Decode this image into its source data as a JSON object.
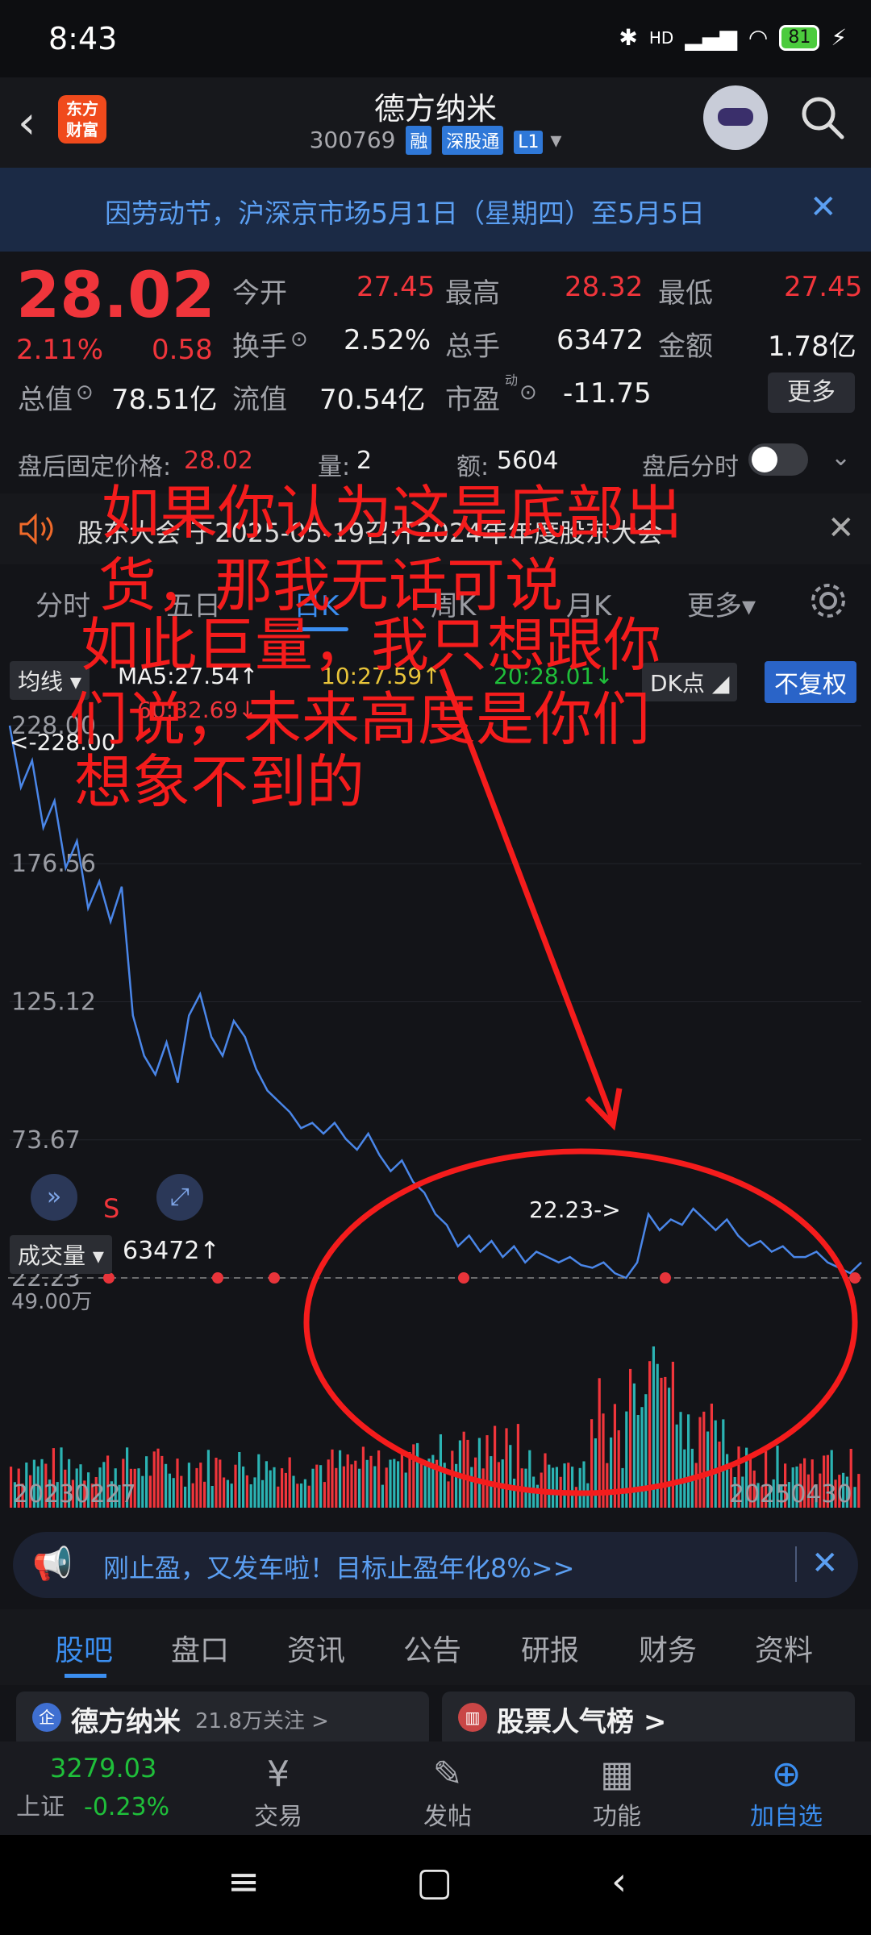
{
  "status_bar": {
    "time": "8:43",
    "battery": "81",
    "network": "HD"
  },
  "header": {
    "back_icon": "chevron-left-icon",
    "logo_text_1": "东方",
    "logo_text_2": "财富",
    "stock_name": "德方纳米",
    "stock_code": "300769",
    "tag_rong": "融",
    "tag_shengutong": "深股通",
    "tag_level": "L1"
  },
  "notice": {
    "text": "因劳动节，沪深京市场5月1日（星期四）至5月5日",
    "close": "✕"
  },
  "quote": {
    "price": "28.02",
    "pct": "2.11%",
    "change": "0.58",
    "open_label": "今开",
    "open": "27.45",
    "high_label": "最高",
    "high": "28.32",
    "low_label": "最低",
    "low": "27.45",
    "turnover_label": "换手",
    "turnover": "2.52%",
    "volume_label": "总手",
    "volume": "63472",
    "amount_label": "金额",
    "amount": "1.78亿",
    "mcap_label": "总值",
    "mcap": "78.51亿",
    "float_label": "流值",
    "float": "70.54亿",
    "pe_label": "市盈",
    "pe_sup": "动",
    "pe": "-11.75",
    "more": "更多"
  },
  "after_hours": {
    "fixed_label": "盘后固定价格:",
    "fixed_price": "28.02",
    "qty_label": "量:",
    "qty": "2",
    "amt_label": "额:",
    "amt": "5604",
    "timeshare_label": "盘后分时"
  },
  "meeting": {
    "text": "股东大会   于2025-05-19召开2024年年度股东大会"
  },
  "period_tabs": [
    "分时",
    "五日",
    "日K",
    "周K",
    "月K",
    "更多▾"
  ],
  "chart": {
    "ma_selector": "均线",
    "ma5": "MA5:27.54↑",
    "ma10": "10:27.59↑",
    "ma20": "20:28.01↓",
    "ma60": "60:32.69↓",
    "dk": "DK点",
    "fuquan": "不复权",
    "max_label": "<-228.00",
    "min_label": "22.23->",
    "s_marker": "S",
    "volume_selector": "成交量",
    "volume_value": "63472↑",
    "vol_axis_top": "49.00万",
    "date_start": "20230227",
    "date_end": "20250430"
  },
  "chart_data": {
    "type": "line",
    "title": "",
    "y_ticks": [
      "228.00",
      "176.56",
      "125.12",
      "73.67",
      "22.23"
    ],
    "ylim": [
      22.23,
      228.0
    ],
    "x_range": [
      "20230227",
      "20250430"
    ],
    "series": [
      {
        "values": [
          228,
          205,
          215,
          190,
          200,
          175,
          185,
          160,
          170,
          155,
          168,
          120,
          105,
          98,
          110,
          95,
          120,
          128,
          112,
          105,
          118,
          112,
          100,
          92,
          88,
          84,
          78,
          80,
          76,
          80,
          74,
          70,
          76,
          68,
          62,
          66,
          58,
          54,
          46,
          42,
          34,
          38,
          32,
          36,
          30,
          34,
          28,
          32,
          30,
          28,
          30,
          27,
          26,
          28,
          24,
          22.23,
          28,
          46,
          40,
          44,
          42,
          48,
          44,
          40,
          44,
          38,
          34,
          36,
          32,
          34,
          30,
          30,
          32,
          28,
          26,
          24,
          28
        ]
      }
    ],
    "volume_max": "49.00万"
  },
  "overlay_text": {
    "line1": "如果你认为这是底部出",
    "line2": "货，那我无话可说",
    "line3": "如此巨量，我只想跟你",
    "line4": "们说，未来高度是你们",
    "line5": "想象不到的"
  },
  "ad": {
    "text": "刚止盈，又发车啦！目标止盈年化8%>>",
    "close": "✕"
  },
  "bottom_tabs": [
    "股吧",
    "盘口",
    "资讯",
    "公告",
    "研报",
    "财务",
    "资料"
  ],
  "cards": {
    "left_title": "德方纳米",
    "left_follow": "21.8万关注 >",
    "right_title": "股票人气榜 >"
  },
  "bottom_nav": {
    "index_value": "3279.03",
    "index_name": "上证",
    "index_change": "-0.23%",
    "trade": "交易",
    "post": "发帖",
    "function": "功能",
    "add": "加自选"
  },
  "colors": {
    "up": "#f0353b",
    "down": "#1fbf3a",
    "accent": "#3b8ef0",
    "line": "#4a86e8",
    "teal": "#2bb3b3",
    "annotation": "#f51c1c"
  }
}
